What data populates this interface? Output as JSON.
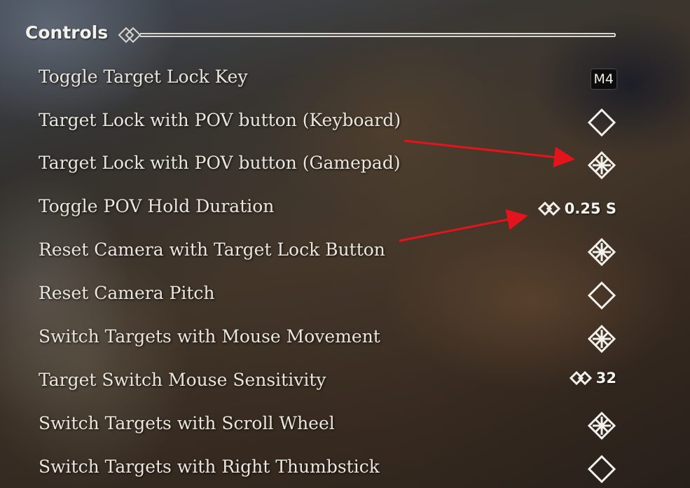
{
  "header": {
    "title": "Controls"
  },
  "rows": [
    {
      "label": "Toggle Target Lock Key",
      "control": "keycap",
      "value": "M4"
    },
    {
      "label": "Target Lock with POV button (Keyboard)",
      "control": "toggle",
      "state": "off"
    },
    {
      "label": "Target Lock with POV button (Gamepad)",
      "control": "toggle",
      "state": "on"
    },
    {
      "label": "Toggle POV Hold Duration",
      "control": "slider",
      "value": "0.25 S"
    },
    {
      "label": "Reset Camera with Target Lock Button",
      "control": "toggle",
      "state": "on"
    },
    {
      "label": "Reset Camera Pitch",
      "control": "toggle",
      "state": "off"
    },
    {
      "label": "Switch Targets with Mouse Movement",
      "control": "toggle",
      "state": "on"
    },
    {
      "label": "Target Switch Mouse Sensitivity",
      "control": "slider",
      "value": "32"
    },
    {
      "label": "Switch Targets with Scroll Wheel",
      "control": "toggle",
      "state": "on"
    },
    {
      "label": "Switch Targets with Right Thumbstick",
      "control": "toggle",
      "state": "off"
    }
  ],
  "icons": {
    "toggle_on": "checked-diamond-icon",
    "toggle_off": "empty-diamond-icon",
    "slider": "slider-arrows-icon"
  },
  "colors": {
    "text": "#eae6de",
    "annotation_arrow": "#e4141c"
  }
}
